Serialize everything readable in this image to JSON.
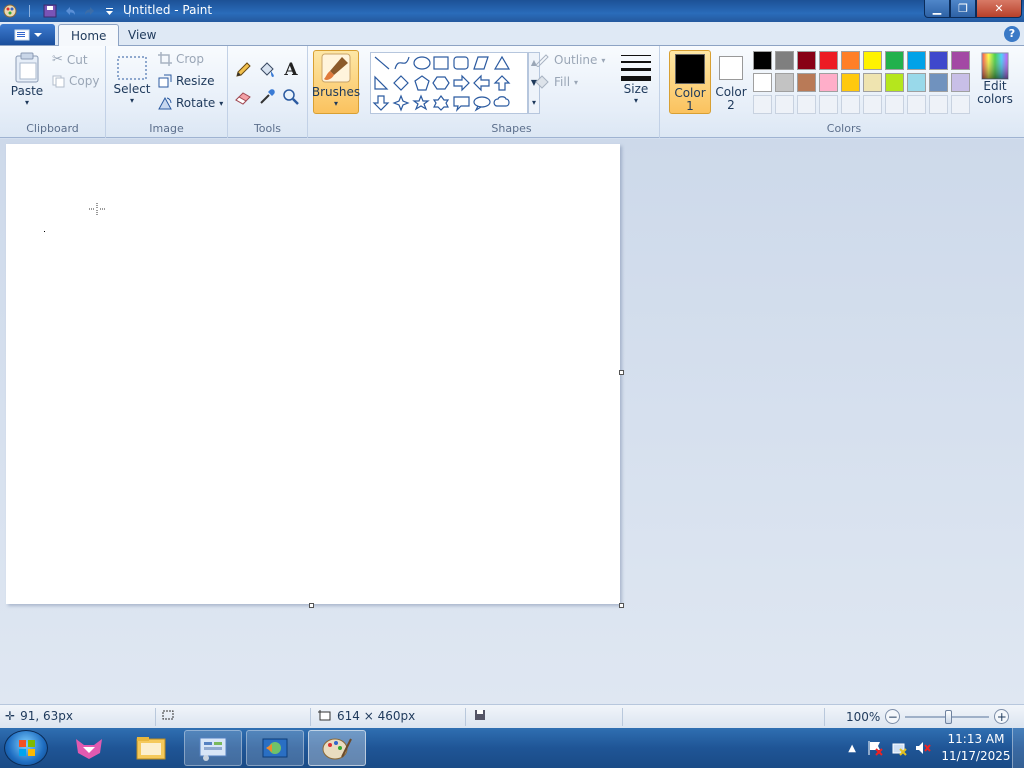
{
  "window": {
    "title": "Untitled - Paint"
  },
  "tabs": [
    {
      "label": "Home",
      "active": true
    },
    {
      "label": "View",
      "active": false
    }
  ],
  "ribbon": {
    "clipboard": {
      "group_label": "Clipboard",
      "paste": "Paste",
      "cut": "Cut",
      "copy": "Copy"
    },
    "image": {
      "group_label": "Image",
      "select": "Select",
      "crop": "Crop",
      "resize": "Resize",
      "rotate": "Rotate"
    },
    "tools": {
      "group_label": "Tools"
    },
    "brushes": {
      "label": "Brushes"
    },
    "shapes": {
      "group_label": "Shapes",
      "outline": "Outline",
      "fill": "Fill"
    },
    "size": {
      "label": "Size"
    },
    "colors": {
      "group_label": "Colors",
      "color1_label": "Color 1",
      "color1_line1": "Color",
      "color1_line2": "1",
      "color2_line1": "Color",
      "color2_line2": "2",
      "color1_value": "#000000",
      "color2_value": "#ffffff",
      "edit_line1": "Edit",
      "edit_line2": "colors",
      "palette_row1": [
        "#000000",
        "#7f7f7f",
        "#880015",
        "#ed1c24",
        "#ff7f27",
        "#fff200",
        "#22b14c",
        "#00a2e8",
        "#3f48cc",
        "#a349a4"
      ],
      "palette_row2": [
        "#ffffff",
        "#c3c3c3",
        "#b97a57",
        "#ffaec9",
        "#ffc90e",
        "#efe4b0",
        "#b5e61d",
        "#99d9ea",
        "#7092be",
        "#c8bfe7"
      ]
    }
  },
  "canvas": {
    "background": "#ffffff"
  },
  "status": {
    "cursor_position": "91, 63px",
    "image_size": "614 × 460px",
    "zoom": "100%"
  },
  "taskbar": {
    "apps": [
      "Firefox",
      "File Explorer",
      "Control Panel",
      "Remote Desktop",
      "Paint"
    ],
    "time": "11:13 AM",
    "date": "11/17/2025"
  }
}
